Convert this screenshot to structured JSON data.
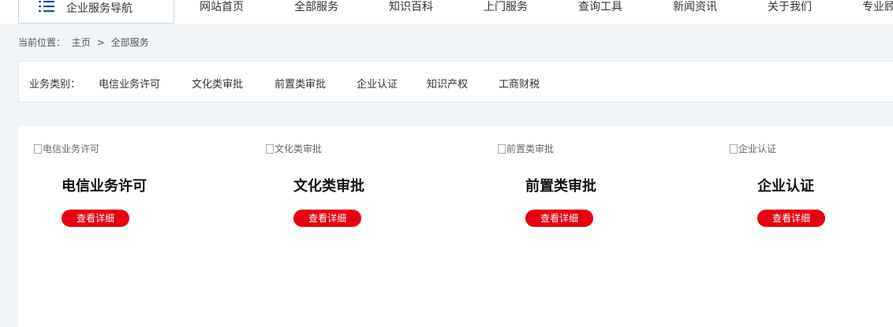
{
  "header": {
    "nav_title": "企业服务导航",
    "nav_links": [
      "网站首页",
      "全部服务",
      "知识百科",
      "上门服务",
      "查询工具",
      "新闻资讯",
      "关于我们",
      "专业顾问"
    ]
  },
  "breadcrumb": {
    "prefix": "当前位置：",
    "home": "主页",
    "separator": ">",
    "current": "全部服务"
  },
  "filter": {
    "label": "业务类别：",
    "items": [
      "电信业务许可",
      "文化类审批",
      "前置类审批",
      "企业认证",
      "知识产权",
      "工商财税"
    ]
  },
  "cards": [
    {
      "img_alt": "电信业务许可",
      "title": "电信业务许可",
      "button": "查看详细"
    },
    {
      "img_alt": "文化类审批",
      "title": "文化类审批",
      "button": "查看详细"
    },
    {
      "img_alt": "前置类审批",
      "title": "前置类审批",
      "button": "查看详细"
    },
    {
      "img_alt": "企业认证",
      "title": "企业认证",
      "button": "查看详细"
    }
  ],
  "colors": {
    "accent_red": "#e60012",
    "nav_icon_blue": "#1a4fa0"
  }
}
